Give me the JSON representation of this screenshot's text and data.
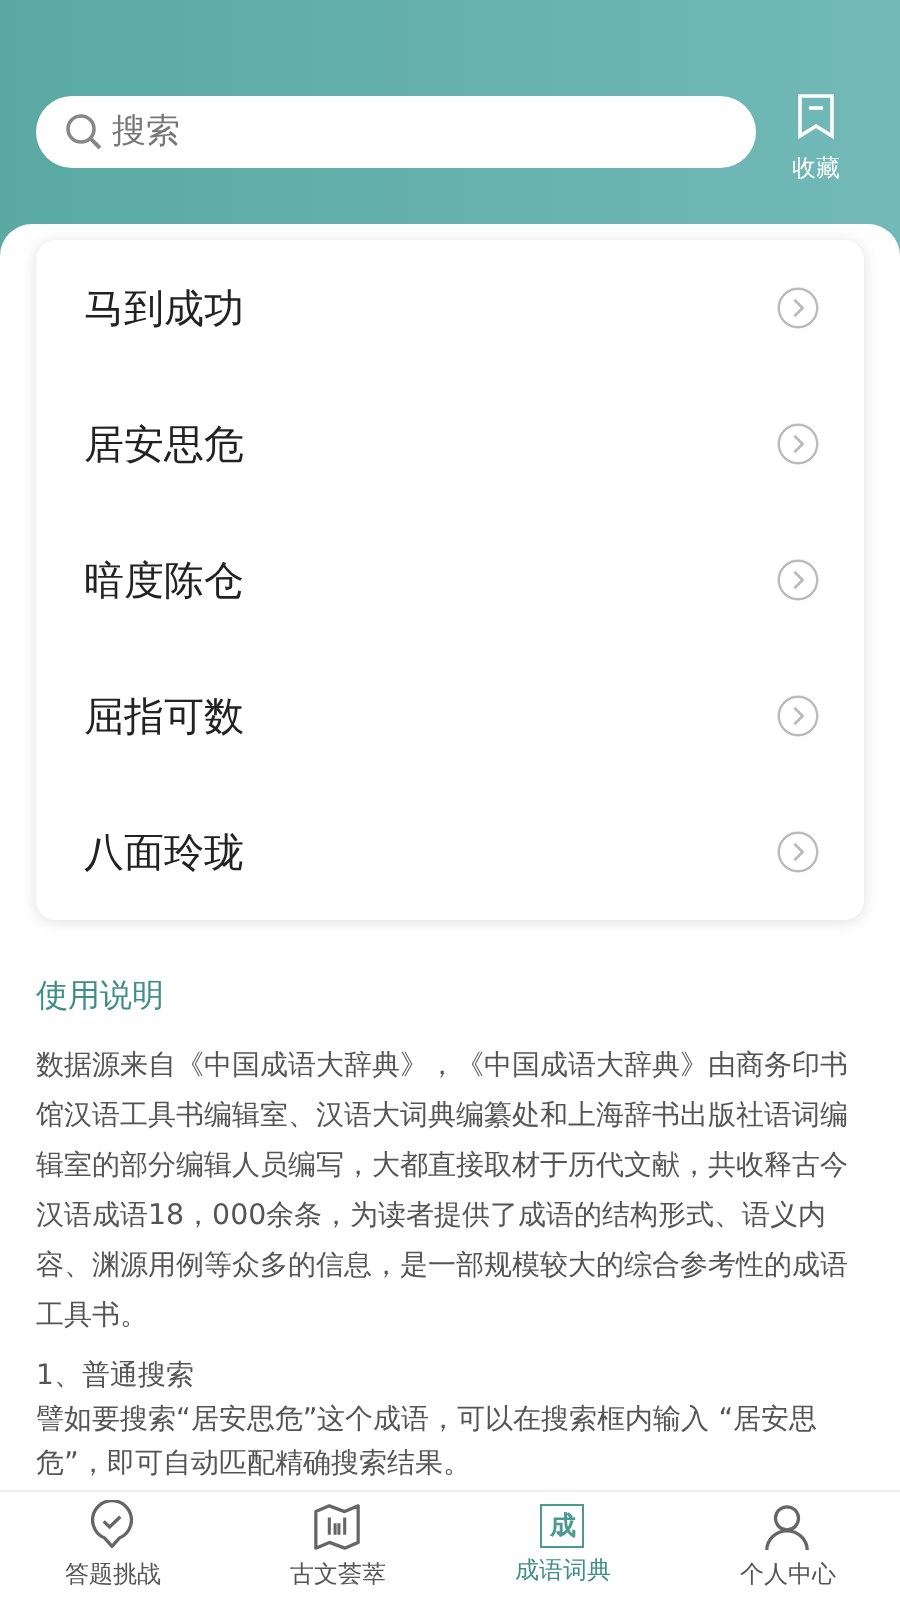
{
  "search": {
    "placeholder": "搜索"
  },
  "favorites": {
    "label": "收藏"
  },
  "idioms": [
    {
      "text": "马到成功"
    },
    {
      "text": "居安思危"
    },
    {
      "text": "暗度陈仓"
    },
    {
      "text": "屈指可数"
    },
    {
      "text": "八面玲珑"
    }
  ],
  "instructions": {
    "title": "使用说明",
    "intro": "数据源来自《中国成语大辞典》，《中国成语大辞典》由商务印书馆汉语工具书编辑室、汉语大词典编纂处和上海辞书出版社语词编辑室的部分编辑人员编写，大都直接取材于历代文献，共收释古今汉语成语18，000余条，为读者提供了成语的结构形式、语义内容、渊源用例等众多的信息，是一部规模较大的综合参考性的成语工具书。",
    "sections": [
      {
        "heading": "1、普通搜索",
        "body": "譬如要搜索“居安思危”这个成语，可以在搜索框内输入 “居安思危”，即可自动匹配精确搜索结果。"
      }
    ]
  },
  "tabs": [
    {
      "label": "答题挑战",
      "kind": "check",
      "selected": false
    },
    {
      "label": "古文荟萃",
      "kind": "book",
      "selected": false
    },
    {
      "label": "成语词典",
      "kind": "char",
      "icon_text": "成",
      "selected": true
    },
    {
      "label": "个人中心",
      "kind": "person",
      "selected": false
    }
  ]
}
